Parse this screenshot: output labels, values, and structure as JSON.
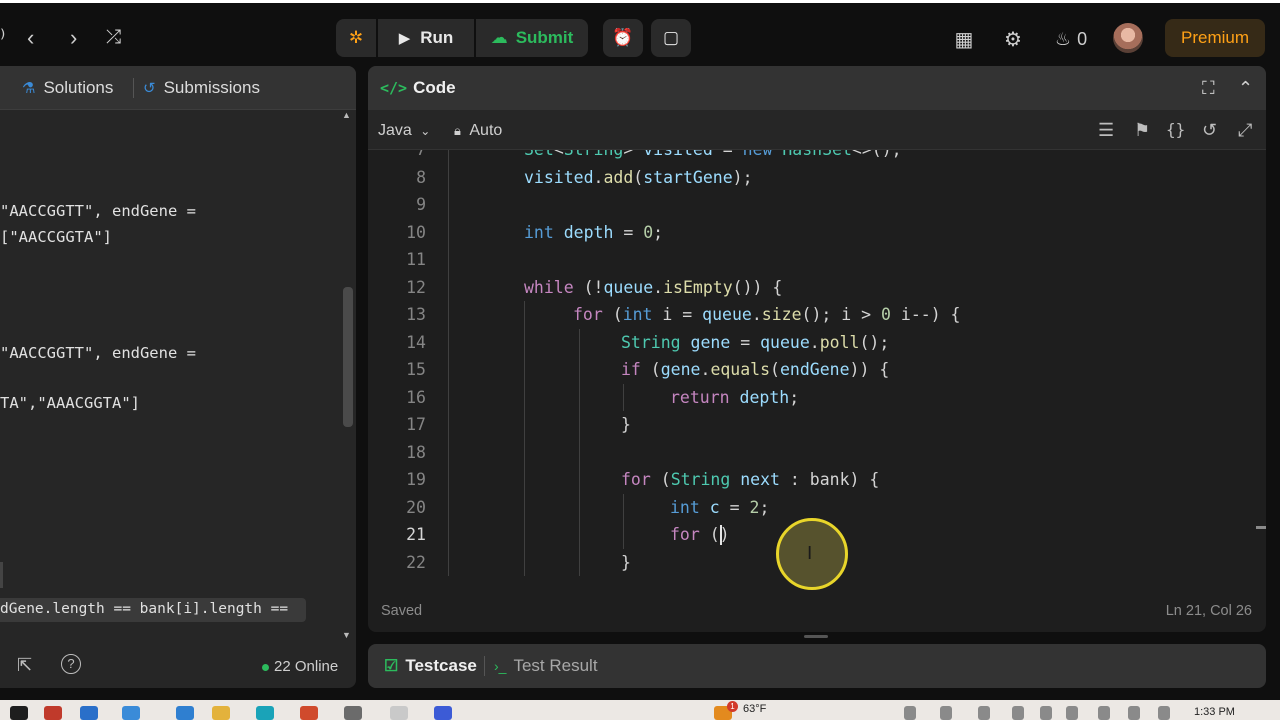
{
  "topbar": {
    "run_label": "Run",
    "submit_label": "Submit",
    "streak_count": "0",
    "premium_label": "Premium",
    "icons": [
      "chevron-left-icon",
      "chevron-right-icon",
      "shuffle-icon",
      "debug-icon",
      "play-icon",
      "cloud-upload-icon",
      "alarm-icon",
      "note-icon",
      "grid-icon",
      "gear-icon",
      "fire-icon"
    ]
  },
  "left_panel": {
    "tabs": [
      "Solutions",
      "Submissions"
    ],
    "example1_line1": "\"AACCGGTT\", endGene =",
    "example1_line2": "[\"AACCGGTA\"]",
    "example2_line1": "\"AACCGGTT\", endGene =",
    "example2_line2": "TA\",\"AAACGGTA\"]",
    "constraint": "dGene.length == bank[i].length ==",
    "online_label": "22 Online"
  },
  "code_panel": {
    "title": "Code",
    "language": "Java",
    "mode": "Auto",
    "status": "Saved",
    "cursor_position": "Ln 21, Col 26",
    "lines": [
      {
        "num": "7",
        "indent": 1,
        "text": "Set<String> visited = new HashSet<>();"
      },
      {
        "num": "8",
        "indent": 1,
        "text": "visited.add(startGene);"
      },
      {
        "num": "9",
        "indent": 1,
        "text": ""
      },
      {
        "num": "10",
        "indent": 1,
        "text": "int depth = 0;"
      },
      {
        "num": "11",
        "indent": 1,
        "text": ""
      },
      {
        "num": "12",
        "indent": 1,
        "text": "while (!queue.isEmpty()) {"
      },
      {
        "num": "13",
        "indent": 2,
        "text": "for (int i = queue.size(); i > 0 i--) {"
      },
      {
        "num": "14",
        "indent": 3,
        "text": "String gene = queue.poll();"
      },
      {
        "num": "15",
        "indent": 3,
        "text": "if (gene.equals(endGene)) {"
      },
      {
        "num": "16",
        "indent": 4,
        "text": "return depth;"
      },
      {
        "num": "17",
        "indent": 3,
        "text": "}"
      },
      {
        "num": "18",
        "indent": 3,
        "text": ""
      },
      {
        "num": "19",
        "indent": 3,
        "text": "for (String next : bank) {"
      },
      {
        "num": "20",
        "indent": 4,
        "text": "int c = 2;"
      },
      {
        "num": "21",
        "indent": 4,
        "text": "for ()"
      },
      {
        "num": "22",
        "indent": 3,
        "text": "}"
      }
    ]
  },
  "test_panel": {
    "tabs": [
      "Testcase",
      "Test Result"
    ]
  },
  "taskbar": {
    "weather": "63°F",
    "weather_badge": "1",
    "time": "1:33 PM"
  },
  "colors": {
    "accent_green": "#2cbb5d",
    "premium_orange": "#ffa116",
    "keyword_blue": "#569cd6",
    "type_teal": "#4ec9b0"
  }
}
